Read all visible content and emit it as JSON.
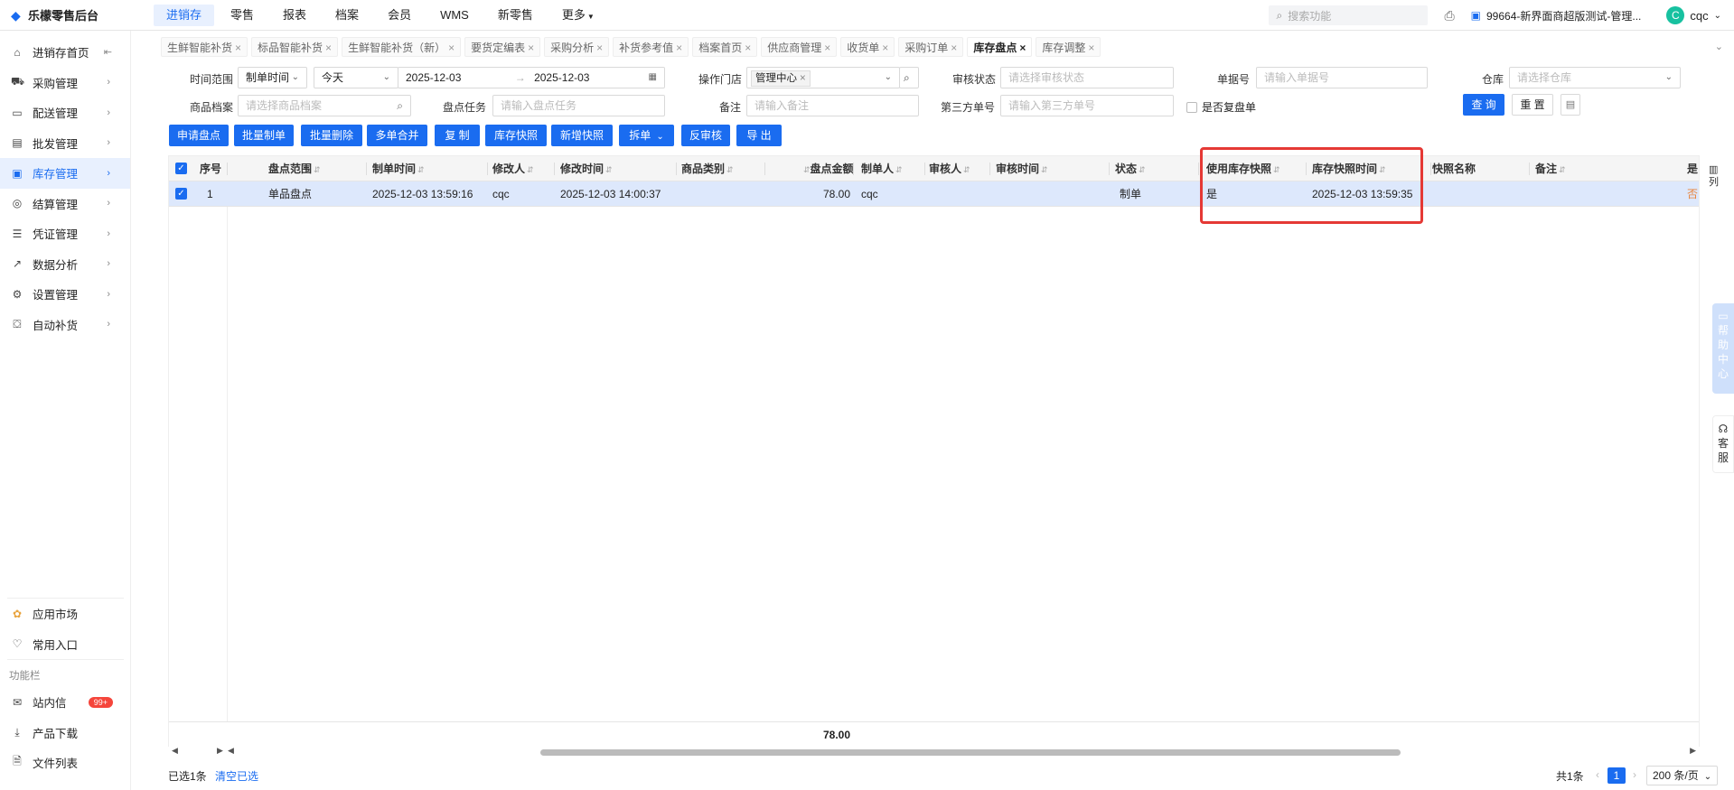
{
  "app": {
    "title": "乐檬零售后台"
  },
  "topnav": [
    "进销存",
    "零售",
    "报表",
    "档案",
    "会员",
    "WMS",
    "新零售",
    "更多"
  ],
  "search": {
    "placeholder": "搜索功能"
  },
  "store": {
    "label": "99664-新界面商超版测试-管理..."
  },
  "user": {
    "initial": "C",
    "name": "cqc"
  },
  "sidebar": {
    "items": [
      {
        "label": "进销存首页",
        "icon": "home-icon"
      },
      {
        "label": "采购管理",
        "icon": "cart-icon"
      },
      {
        "label": "配送管理",
        "icon": "truck-icon"
      },
      {
        "label": "批发管理",
        "icon": "wholesale-icon"
      },
      {
        "label": "库存管理",
        "icon": "inventory-icon"
      },
      {
        "label": "结算管理",
        "icon": "settle-icon"
      },
      {
        "label": "凭证管理",
        "icon": "voucher-icon"
      },
      {
        "label": "数据分析",
        "icon": "chart-icon"
      },
      {
        "label": "设置管理",
        "icon": "settings-icon"
      },
      {
        "label": "自动补货",
        "icon": "replenish-icon"
      }
    ],
    "bottom": {
      "app_market": "应用市场",
      "common_entry": "常用入口",
      "section_title": "功能栏",
      "messages": "站内信",
      "messages_badge": "99+",
      "download": "产品下载",
      "files": "文件列表"
    }
  },
  "tabs": [
    {
      "label": "生鲜智能补货"
    },
    {
      "label": "标品智能补货"
    },
    {
      "label": "生鲜智能补货（新）"
    },
    {
      "label": "要货定编表"
    },
    {
      "label": "采购分析"
    },
    {
      "label": "补货参考值"
    },
    {
      "label": "档案首页"
    },
    {
      "label": "供应商管理"
    },
    {
      "label": "收货单"
    },
    {
      "label": "采购订单"
    },
    {
      "label": "库存盘点"
    },
    {
      "label": "库存调整"
    }
  ],
  "filters": {
    "time_range_label": "时间范围",
    "time_type": "制单时间",
    "period": "今天",
    "date_from": "2025-12-03",
    "date_sep": "→",
    "date_to": "2025-12-03",
    "store_label": "操作门店",
    "store_tag": "管理中心",
    "audit_label": "审核状态",
    "audit_placeholder": "请选择审核状态",
    "order_no_label": "单据号",
    "order_no_placeholder": "请输入单据号",
    "warehouse_label": "仓库",
    "warehouse_placeholder": "请选择仓库",
    "product_label": "商品档案",
    "product_placeholder": "请选择商品档案",
    "task_label": "盘点任务",
    "task_placeholder": "请输入盘点任务",
    "remark_label": "备注",
    "remark_placeholder": "请输入备注",
    "third_label": "第三方单号",
    "third_placeholder": "请输入第三方单号",
    "recheck_label": "是否复盘单",
    "query": "查 询",
    "reset": "重 置"
  },
  "actions": [
    "申请盘点",
    "批量制单",
    "批量删除",
    "多单合并",
    "复 制",
    "库存快照",
    "新增快照",
    "拆单",
    "反审核",
    "导 出"
  ],
  "table": {
    "columns": [
      "序号",
      "盘点范围",
      "制单时间",
      "修改人",
      "修改时间",
      "商品类别",
      "盘点金额",
      "制单人",
      "审核人",
      "审核时间",
      "状态",
      "使用库存快照",
      "库存快照时间",
      "快照名称",
      "备注",
      "是否"
    ],
    "rows": [
      {
        "seq": "1",
        "scope": "单品盘点",
        "created": "2025-12-03 13:59:16",
        "modifier": "cqc",
        "modified": "2025-12-03 14:00:37",
        "category": "",
        "amount": "78.00",
        "creator": "cqc",
        "auditor": "",
        "audit_time": "",
        "status": "制单",
        "use_snapshot": "是",
        "snapshot_time": "2025-12-03 13:59:35",
        "snapshot_name": "",
        "remark": "",
        "last": "否"
      }
    ],
    "total_amount": "78.00",
    "col_setting": "列"
  },
  "footer": {
    "selected": "已选1条",
    "clear": "清空已选",
    "total": "共1条",
    "page": "1",
    "page_size": "200 条/页"
  },
  "float": {
    "help": "帮助中心",
    "service": "客服"
  }
}
